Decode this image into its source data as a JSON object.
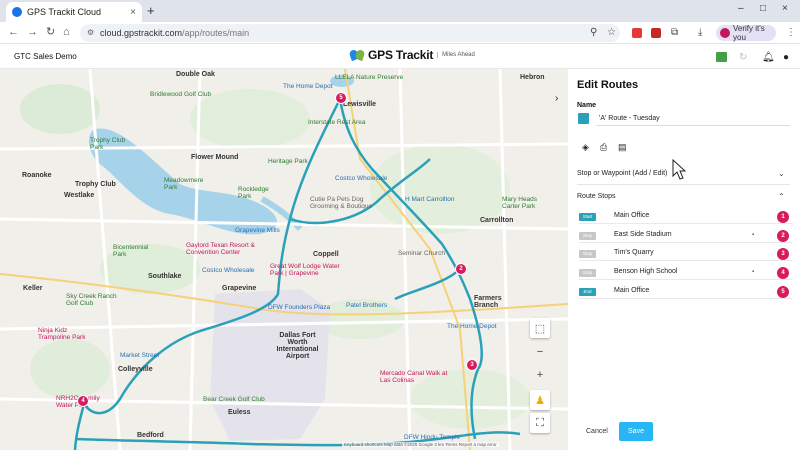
{
  "browser": {
    "tab_title": "GPS Trackit Cloud",
    "tab_close": "×",
    "new_tab": "+",
    "url_domain": "cloud.gpstrackit.com",
    "url_path": "/app/routes/main",
    "profile_label": "Verify it's you",
    "window_controls": [
      "–",
      "□",
      "×"
    ]
  },
  "app": {
    "company": "GTC Sales Demo",
    "brand_name": "GPS Trackit",
    "brand_tagline": "Miles Ahead"
  },
  "map": {
    "labels": [
      {
        "text": "Double Oak",
        "cls": "bold"
      },
      {
        "text": "Lewisville",
        "cls": "bold"
      },
      {
        "text": "Hebron",
        "cls": "bold"
      },
      {
        "text": "LLELA Nature Preserve",
        "cls": "green"
      },
      {
        "text": "The Home Depot",
        "cls": "blue"
      },
      {
        "text": "Bridlewood Golf Club",
        "cls": "green"
      },
      {
        "text": "Interstate Rest Area",
        "cls": "green"
      },
      {
        "text": "Trophy Club Park",
        "cls": "green"
      },
      {
        "text": "Flower Mound",
        "cls": "bold"
      },
      {
        "text": "Heritage Park",
        "cls": "green"
      },
      {
        "text": "Roanoke",
        "cls": "bold"
      },
      {
        "text": "Trophy Club",
        "cls": "bold"
      },
      {
        "text": "Westlake",
        "cls": "bold"
      },
      {
        "text": "Costco Wholesale",
        "cls": "blue"
      },
      {
        "text": "Rockledge Park",
        "cls": "green"
      },
      {
        "text": "Meadowmere Park",
        "cls": "green"
      },
      {
        "text": "Cutie Pa Pets Dog Grooming & Boutique",
        "cls": "gray"
      },
      {
        "text": "H Mart Carrollton",
        "cls": "blue"
      },
      {
        "text": "Mary Heads Carter Park",
        "cls": "green"
      },
      {
        "text": "Carrollton",
        "cls": "bold"
      },
      {
        "text": "Grapevine Mills",
        "cls": "blue"
      },
      {
        "text": "Gaylord Texan Resort & Convention Center",
        "cls": "pink"
      },
      {
        "text": "Bicentennial Park",
        "cls": "green"
      },
      {
        "text": "Costco Wholesale",
        "cls": "blue"
      },
      {
        "text": "Great Wolf Lodge Water Park | Grapevine",
        "cls": "pink"
      },
      {
        "text": "Coppell",
        "cls": "bold"
      },
      {
        "text": "Seminar Church",
        "cls": "gray"
      },
      {
        "text": "Southlake",
        "cls": "bold"
      },
      {
        "text": "Grapevine",
        "cls": "bold"
      },
      {
        "text": "Farmers Branch",
        "cls": "bold"
      },
      {
        "text": "Keller",
        "cls": "bold"
      },
      {
        "text": "Sky Creek Ranch Golf Club",
        "cls": "green"
      },
      {
        "text": "DFW Founders Plaza",
        "cls": "blue"
      },
      {
        "text": "Patel Brothers",
        "cls": "blue"
      },
      {
        "text": "Ninja Kidz Trampoline Park",
        "cls": "pink"
      },
      {
        "text": "Dallas Fort Worth International Airport",
        "cls": "bold"
      },
      {
        "text": "The Home Depot",
        "cls": "blue"
      },
      {
        "text": "Colleyville",
        "cls": "bold"
      },
      {
        "text": "Market Street",
        "cls": "blue"
      },
      {
        "text": "Mercado Canal Walk at Las Colinas",
        "cls": "pink"
      },
      {
        "text": "NRH2O Family Water Park",
        "cls": "pink"
      },
      {
        "text": "Bear Creek Golf Club",
        "cls": "green"
      },
      {
        "text": "Bedford",
        "cls": "bold"
      },
      {
        "text": "DFW Hindu Temple",
        "cls": "blue"
      },
      {
        "text": "Euless",
        "cls": "bold"
      }
    ],
    "attribution": "Keyboard shortcuts  Map data ©2025 Google  2 km  Terms  Report a map error",
    "controls": {
      "layers": "⬚",
      "zoom_out": "−",
      "zoom_in": "+",
      "pegman": "♟",
      "fullscreen": "⛶"
    },
    "collapse_arrow": "›"
  },
  "panel": {
    "title": "Edit Routes",
    "name_label": "Name",
    "route_name": "'A' Route - Tuesday",
    "route_color": "#2aa1b8",
    "section_stops": "Stop or Waypoint (Add / Edit)",
    "section_route_stops": "Route Stops",
    "stops": [
      {
        "badge": "Start",
        "name": "Main Office",
        "note": "",
        "num": "1"
      },
      {
        "badge": "Stop",
        "name": "East Side Stadium",
        "note": "▪",
        "num": "2"
      },
      {
        "badge": "Stop",
        "name": "Tim's Quarry",
        "note": "",
        "num": "3"
      },
      {
        "badge": "Stop",
        "name": "Benson High School",
        "note": "▪",
        "num": "4"
      },
      {
        "badge": "End",
        "name": "Main Office",
        "note": "",
        "num": "5"
      }
    ],
    "cancel_label": "Cancel",
    "save_label": "Save"
  },
  "colors": {
    "accent": "#29b6f6",
    "route": "#2aa1b8",
    "pin": "#d81b60"
  }
}
